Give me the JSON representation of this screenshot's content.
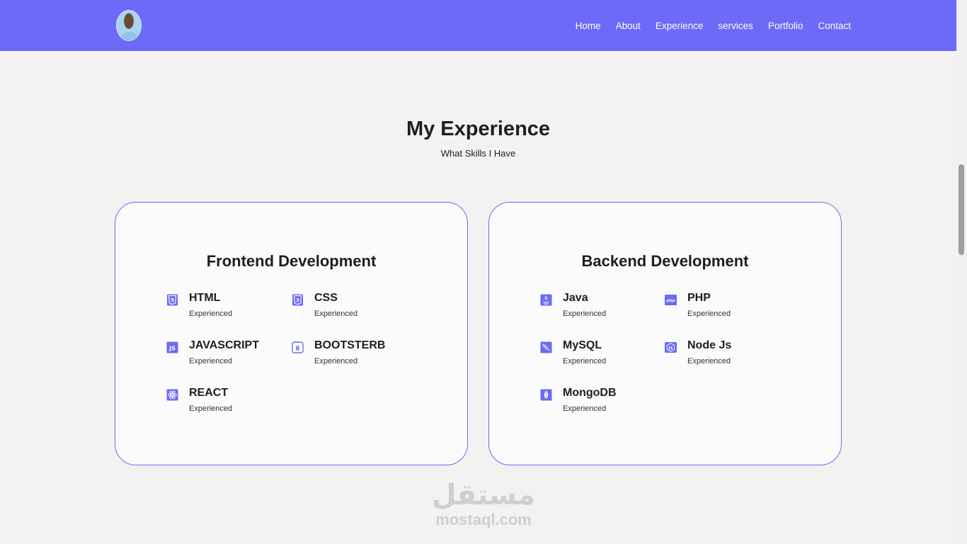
{
  "nav": {
    "links": [
      "Home",
      "About",
      "Experience",
      "services",
      "Portfolio",
      "Contact"
    ]
  },
  "colors": {
    "accent": "#6c6af6",
    "background": "#f3f2f0",
    "card": "#fbfbfb"
  },
  "section": {
    "title": "My Experience",
    "subtitle": "What Skills I Have"
  },
  "frontend": {
    "title": "Frontend Development",
    "skills": [
      {
        "name": "HTML",
        "level": "Experienced",
        "icon": "html5-icon"
      },
      {
        "name": "CSS",
        "level": "Experienced",
        "icon": "css3-icon"
      },
      {
        "name": "JAVASCRIPT",
        "level": "Experienced",
        "icon": "javascript-icon"
      },
      {
        "name": "BOOTSTERB",
        "level": "Experienced",
        "icon": "bootstrap-icon"
      },
      {
        "name": "REACT",
        "level": "Experienced",
        "icon": "react-icon"
      }
    ]
  },
  "backend": {
    "title": "Backend Development",
    "skills": [
      {
        "name": "Java",
        "level": "Experienced",
        "icon": "java-icon"
      },
      {
        "name": "PHP",
        "level": "Experienced",
        "icon": "php-icon"
      },
      {
        "name": "MySQL",
        "level": "Experienced",
        "icon": "mysql-icon"
      },
      {
        "name": "Node Js",
        "level": "Experienced",
        "icon": "nodejs-icon"
      },
      {
        "name": "MongoDB",
        "level": "Experienced",
        "icon": "mongodb-icon"
      }
    ]
  },
  "watermark": {
    "arabic": "مستقل",
    "latin": "mostaql.com"
  }
}
